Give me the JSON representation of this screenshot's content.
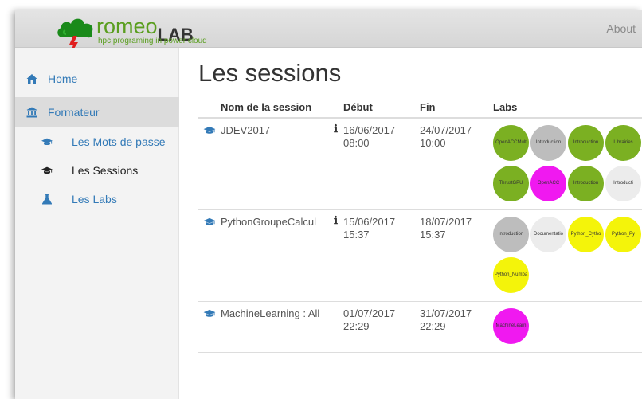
{
  "brand": {
    "name_part1": "romeo",
    "name_part2": "LAB",
    "tagline": "hpc programing in power cloud",
    "color": "#5a9e1f"
  },
  "topnav": {
    "about": "About"
  },
  "sidebar": {
    "items": [
      {
        "label": "Home",
        "icon": "home-icon"
      },
      {
        "label": "Formateur",
        "icon": "institution-icon"
      },
      {
        "label": "Les Mots de passe",
        "icon": "graduation-cap-icon"
      },
      {
        "label": "Les Sessions",
        "icon": "graduation-cap-icon"
      },
      {
        "label": "Les Labs",
        "icon": "flask-icon"
      }
    ],
    "active_item": "Les Sessions"
  },
  "page_title": "Les sessions",
  "table": {
    "headers": [
      "Nom de la session",
      "Début",
      "Fin",
      "Labs"
    ],
    "rows": [
      {
        "name": "JDEV2017",
        "info": "ℹ",
        "debut_date": "16/06/2017",
        "debut_time": "08:00",
        "fin_date": "24/07/2017",
        "fin_time": "10:00",
        "labs": [
          {
            "label": "OpenACCMult",
            "color": "green"
          },
          {
            "label": "Introduction",
            "color": "gray"
          },
          {
            "label": "Introduction",
            "color": "green"
          },
          {
            "label": "Librairies",
            "color": "green"
          },
          {
            "label": "ThrustGPU",
            "color": "green"
          },
          {
            "label": "OpenACC",
            "color": "magenta"
          },
          {
            "label": "Introduction",
            "color": "green"
          },
          {
            "label": "Introducti",
            "color": "light"
          }
        ]
      },
      {
        "name": "PythonGroupeCalcul",
        "info": "ℹ",
        "debut_date": "15/06/2017",
        "debut_time": "15:37",
        "fin_date": "18/07/2017",
        "fin_time": "15:37",
        "labs": [
          {
            "label": "Introduction",
            "color": "gray"
          },
          {
            "label": "Documentatio",
            "color": "light"
          },
          {
            "label": "Python_Cytho",
            "color": "yellow"
          },
          {
            "label": "Python_Py",
            "color": "yellow"
          },
          {
            "label": "Python_Numba",
            "color": "yellow"
          }
        ]
      },
      {
        "name": "MachineLearning : All",
        "info": "",
        "debut_date": "01/07/2017",
        "debut_time": "22:29",
        "fin_date": "31/07/2017",
        "fin_time": "22:29",
        "labs": [
          {
            "label": "MachineLearn",
            "color": "magenta"
          }
        ]
      }
    ]
  },
  "colors": {
    "link": "#337ab7",
    "green": "#7bb022",
    "gray": "#bdbdbd",
    "light": "#ececec",
    "magenta": "#f019f0",
    "yellow": "#f4f40a"
  }
}
